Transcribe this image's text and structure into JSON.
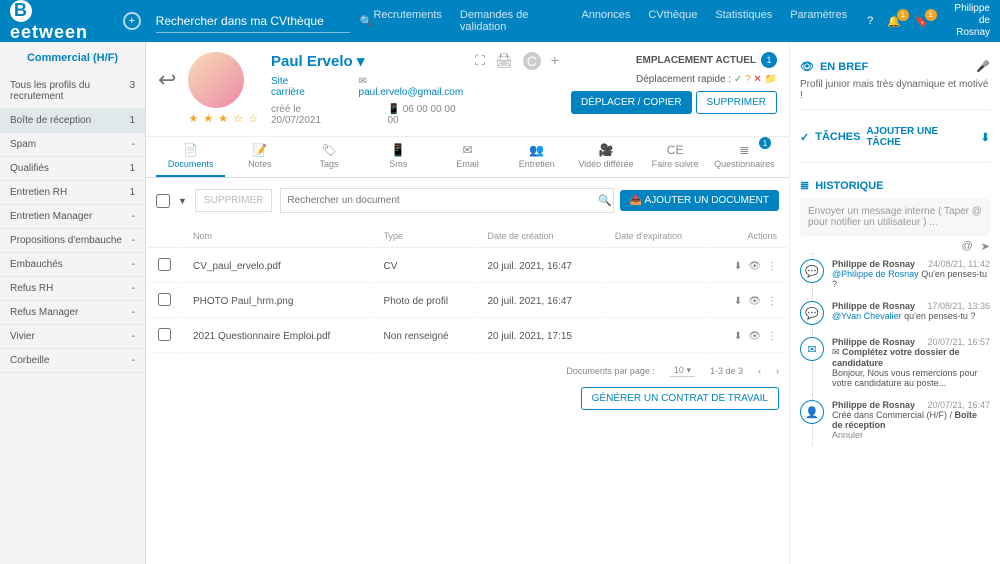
{
  "header": {
    "brand": "eetween",
    "search_placeholder": "Rechercher dans ma CVthèque",
    "nav": [
      "Recrutements",
      "Demandes de validation",
      "Annonces",
      "CVthèque",
      "Statistiques",
      "Paramètres"
    ],
    "notif1": "1",
    "notif2": "1",
    "user_first": "Philippe",
    "user_last": "de Rosnay"
  },
  "sidebar": {
    "title": "Commercial (H/F)",
    "items": [
      {
        "label": "Tous les profils du recrutement",
        "count": "3"
      },
      {
        "label": "Boîte de réception",
        "count": "1",
        "active": true
      },
      {
        "label": "Spam",
        "count": "-"
      },
      {
        "label": "Qualifiés",
        "count": "1"
      },
      {
        "label": "Entretien RH",
        "count": "1"
      },
      {
        "label": "Entretien Manager",
        "count": "-"
      },
      {
        "label": "Propositions d'embauche",
        "count": "-"
      },
      {
        "label": "Embauchés",
        "count": "-"
      },
      {
        "label": "Refus RH",
        "count": "-"
      },
      {
        "label": "Refus Manager",
        "count": "-"
      },
      {
        "label": "Vivier",
        "count": "-"
      },
      {
        "label": "Corbeille",
        "count": "-"
      }
    ]
  },
  "profile": {
    "name": "Paul Ervelo",
    "site": "Site carrière",
    "email": "paul.ervelo@gmail.com",
    "created": "créé le 20/07/2021",
    "phone": "06 00 00 00 00",
    "stars": "★ ★ ★ ☆ ☆",
    "loc_title": "EMPLACEMENT ACTUEL",
    "loc_count": "1",
    "quick_move": "Déplacement rapide :",
    "btn_move": "DÉPLACER / COPIER",
    "btn_delete": "SUPPRIMER"
  },
  "tabs": [
    {
      "icon": "📄",
      "label": "Documents",
      "active": true
    },
    {
      "icon": "📝",
      "label": "Notes"
    },
    {
      "icon": "🏷",
      "label": "Tags"
    },
    {
      "icon": "📱",
      "label": "Sms"
    },
    {
      "icon": "✉",
      "label": "Email"
    },
    {
      "icon": "👥",
      "label": "Entretien"
    },
    {
      "icon": "🎥",
      "label": "Vidéo différée"
    },
    {
      "icon": "CE",
      "label": "Faire suivre"
    },
    {
      "icon": "≣",
      "label": "Questionnaires",
      "badge": "1"
    }
  ],
  "docs": {
    "btn_delete": "SUPPRIMER",
    "search_placeholder": "Rechercher un document",
    "btn_add": "AJOUTER UN DOCUMENT",
    "columns": [
      "Nom",
      "Type",
      "Date de création",
      "Date d'expiration",
      "Actions"
    ],
    "rows": [
      {
        "name": "CV_paul_ervelo.pdf",
        "type": "CV",
        "created": "20 juil. 2021, 16:47",
        "exp": ""
      },
      {
        "name": "PHOTO Paul_hrm.png",
        "type": "Photo de profil",
        "created": "20 juil. 2021, 16:47",
        "exp": ""
      },
      {
        "name": "2021 Questionnaire Emploi.pdf",
        "type": "Non renseigné",
        "created": "20 juil. 2021, 17:15",
        "exp": ""
      }
    ],
    "per_page_label": "Documents par page :",
    "per_page": "10",
    "range": "1-3 de 3",
    "contract_btn": "GÉNÉRER UN CONTRAT DE TRAVAIL"
  },
  "brief": {
    "title": "EN BREF",
    "text": "Profil junior mais très dynamique et motivé !"
  },
  "tasks": {
    "title": "TÂCHES",
    "add": "AJOUTER UNE TÂCHE"
  },
  "history": {
    "title": "HISTORIQUE",
    "placeholder": "Envoyer un message interne ( Taper @ pour notifier un utilisateur ) ...",
    "items": [
      {
        "icon": "💬",
        "user": "Philippe de Rosnay",
        "date": "24/08/21, 11:42",
        "mention": "@Philippe de Rosnay",
        "text": " Qu'en penses-tu ?"
      },
      {
        "icon": "💬",
        "user": "Philippe de Rosnay",
        "date": "17/08/21, 13:36",
        "mention": "@Yvan Chevalier",
        "text": " qu'en penses-tu ?"
      },
      {
        "icon": "✉",
        "user": "Philippe de Rosnay",
        "date": "20/07/21, 16:57",
        "subject": "Complétez votre dossier de candidature",
        "body": "Bonjour, Nous vous remercions pour votre candidature au poste..."
      },
      {
        "icon": "👤",
        "user": "Philippe de Rosnay",
        "date": "20/07/21, 16:47",
        "text": "Créé dans Commercial (H/F) / ",
        "bold": "Boîte de réception",
        "cancel": "Annuler"
      }
    ]
  }
}
